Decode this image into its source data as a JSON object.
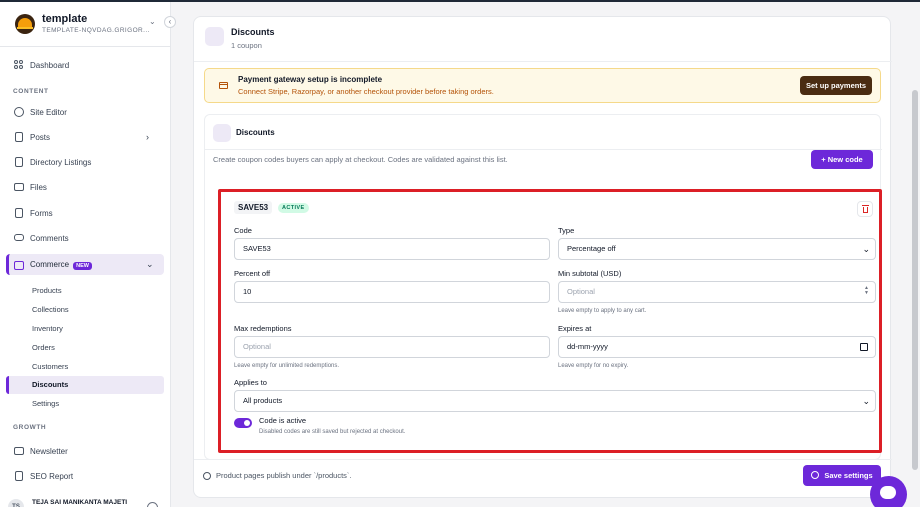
{
  "brand": {
    "name": "template",
    "subtitle": "TEMPLATE-NQVDAG.GRIGOR..."
  },
  "sidebar": {
    "dashboard": "Dashboard",
    "content_label": "CONTENT",
    "site_editor": "Site Editor",
    "posts": "Posts",
    "directory_listings": "Directory Listings",
    "files": "Files",
    "forms": "Forms",
    "comments": "Comments",
    "commerce": "Commerce",
    "commerce_badge": "NEW",
    "commerce_items": [
      "Products",
      "Collections",
      "Inventory",
      "Orders",
      "Customers",
      "Discounts",
      "Settings"
    ],
    "growth_label": "GROWTH",
    "newsletter": "Newsletter",
    "seo_report": "SEO Report",
    "user_initials": "TS",
    "user_name": "TEJA SAI MANIKANTA MAJETI"
  },
  "header": {
    "title": "Discounts",
    "subtitle": "1 coupon"
  },
  "alert": {
    "title": "Payment gateway setup is incomplete",
    "text": "Connect Stripe, Razorpay, or another checkout provider before taking orders.",
    "button": "Set up payments"
  },
  "discounts": {
    "title": "Discounts",
    "description": "Create coupon codes buyers can apply at checkout. Codes are validated against this list.",
    "new_button": "+ New code"
  },
  "coupon": {
    "code_pill": "SAVE53",
    "status": "ACTIVE",
    "code_label": "Code",
    "code_value": "SAVE53",
    "type_label": "Type",
    "type_value": "Percentage off",
    "percent_label": "Percent off",
    "percent_value": "10",
    "min_label": "Min subtotal (USD)",
    "min_placeholder": "Optional",
    "min_hint": "Leave empty to apply to any cart.",
    "max_label": "Max redemptions",
    "max_placeholder": "Optional",
    "max_hint": "Leave empty for unlimited redemptions.",
    "expires_label": "Expires at",
    "expires_placeholder": "dd-mm-yyyy",
    "expires_hint": "Leave empty for no expiry.",
    "applies_label": "Applies to",
    "applies_value": "All products",
    "active_label": "Code is active",
    "active_hint": "Disabled codes are still saved but rejected at checkout."
  },
  "footer": {
    "note": "Product pages publish under `/products`.",
    "save_button": "Save settings"
  },
  "colors": {
    "accent": "#6d28d9",
    "highlight_border": "#dc1f26",
    "alert_bg": "#fef9e7",
    "alert_button": "#4a2c12"
  }
}
